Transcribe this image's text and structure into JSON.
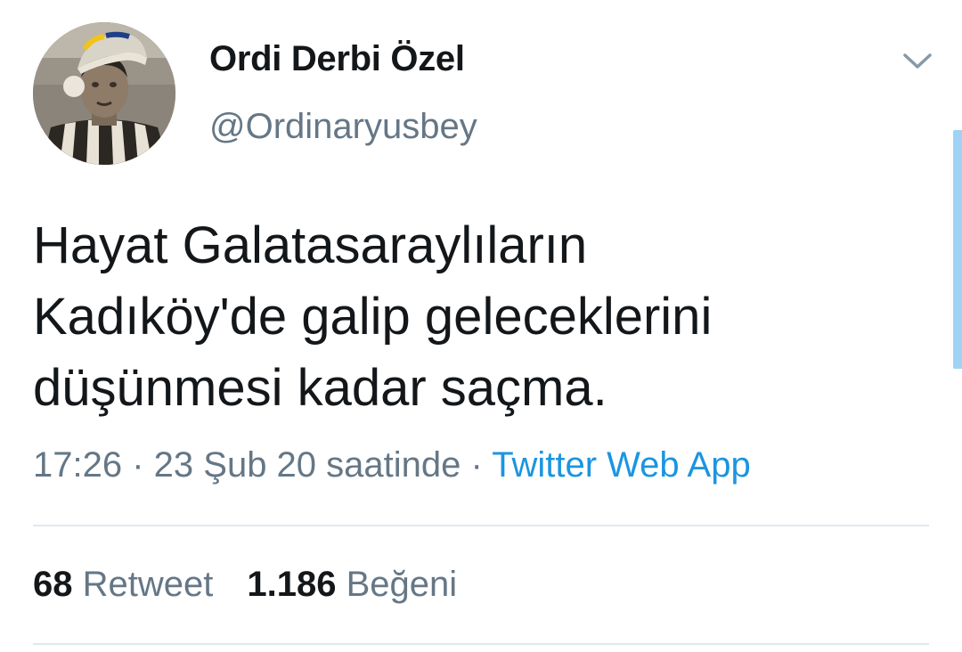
{
  "author": {
    "display_name": "Ordi Derbi Özel",
    "handle": "@Ordinaryusbey",
    "avatar_icon": "profile-photo-icon"
  },
  "tweet": {
    "text_lines": [
      "Hayat Galatasaraylıların",
      "Kadıköy'de galip geleceklerini",
      "düşünmesi kadar saçma."
    ],
    "time": "17:26",
    "separator": " · ",
    "date": "23 Şub 20 saatinde",
    "source": "Twitter Web App"
  },
  "stats": {
    "retweet_count": "68",
    "retweet_label": "Retweet",
    "like_count": "1.186",
    "like_label": "Beğeni"
  },
  "colors": {
    "text": "#14171a",
    "secondary": "#657786",
    "link": "#1b95e0",
    "divider": "#e1e8ed",
    "scroll": "#9fd2f5"
  }
}
